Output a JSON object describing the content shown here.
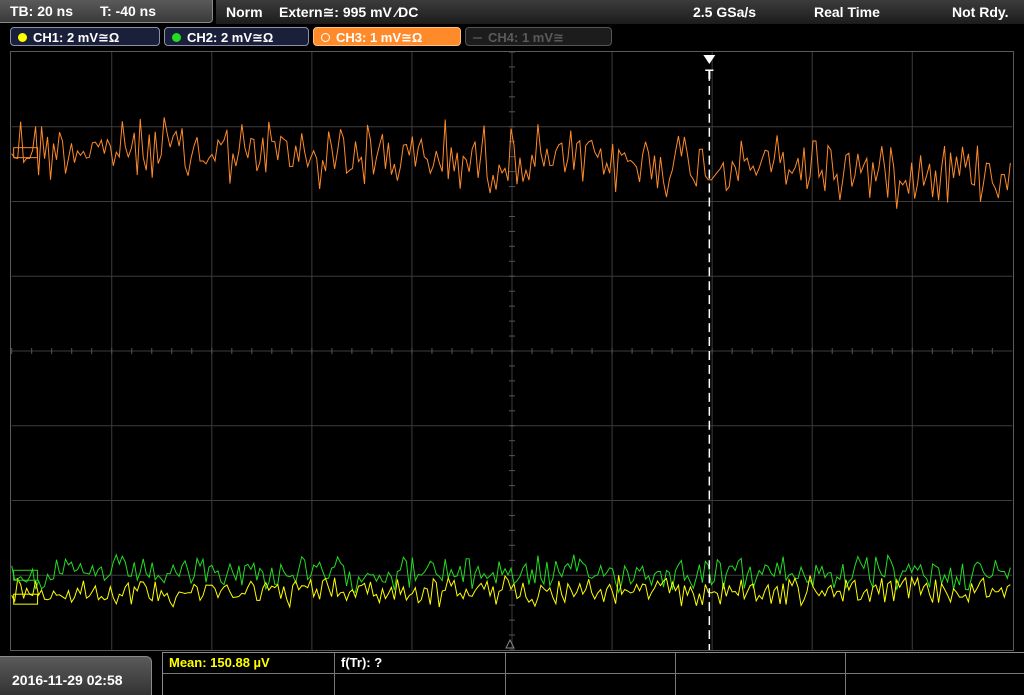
{
  "timebase": {
    "tb_label": "TB: 20 ns",
    "t_label": "T: -40 ns"
  },
  "trigger": {
    "mode": "Norm",
    "source": "Extern≅: 995 mV ⁄DC"
  },
  "acquisition": {
    "sample_rate": "2.5 GSa/s",
    "mode": "Real Time",
    "status": "Not Rdy."
  },
  "channels": [
    {
      "label": "CH1: 2 mV≅Ω",
      "color": "#ffff00",
      "active": true
    },
    {
      "label": "CH2: 2 mV≅Ω",
      "color": "#22dd22",
      "active": true
    },
    {
      "label": "CH3: 1 mV≅Ω",
      "color": "#ff8a2a",
      "active": true
    },
    {
      "label": "CH4: 1 mV≅",
      "color": "#5a5a5a",
      "active": false
    }
  ],
  "colors": {
    "ch1": "#ffff00",
    "ch2": "#22dd22",
    "ch3": "#ff8a2a",
    "grid": "#4a4a4a"
  },
  "trigger_marker": "T",
  "datetime": "2016-11-29 02:58",
  "measurements": {
    "mean": "Mean: 150.88 µV",
    "ftr": "f(Tr): ?"
  },
  "icons": [
    "trigger-position-icon",
    "ground-marker-icon",
    "channel-dot-icon"
  ]
}
